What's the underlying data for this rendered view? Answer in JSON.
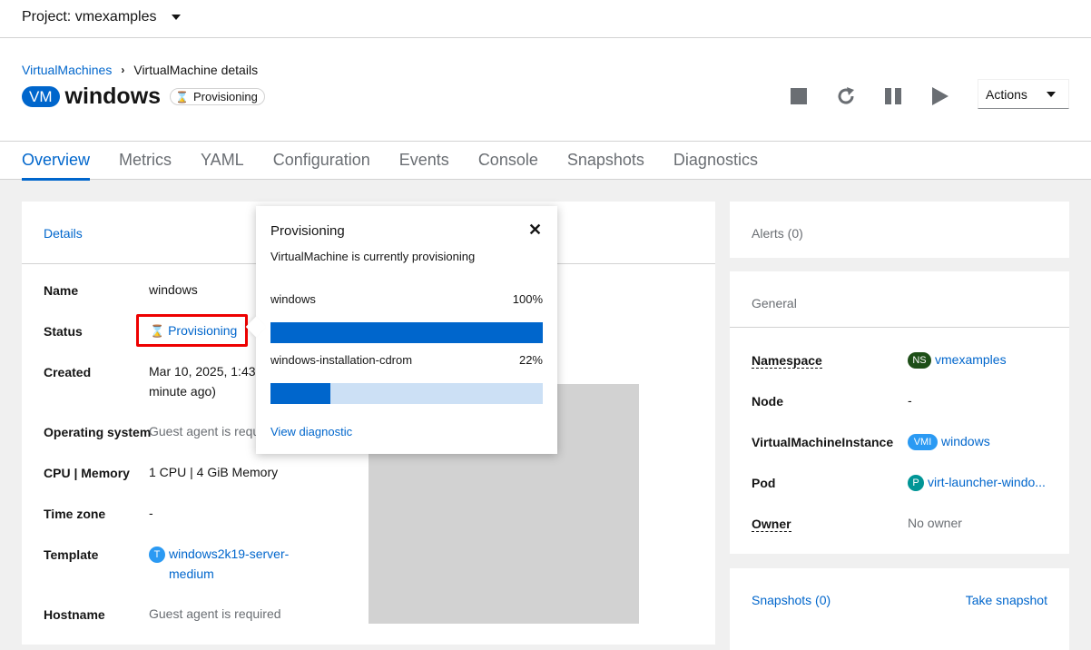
{
  "topbar": {
    "project_label": "Project: vmexamples"
  },
  "breadcrumb": {
    "parent": "VirtualMachines",
    "current": "VirtualMachine details"
  },
  "vm": {
    "badge": "VM",
    "name": "windows",
    "status": "Provisioning"
  },
  "actions": {
    "label": "Actions"
  },
  "tabs": [
    "Overview",
    "Metrics",
    "YAML",
    "Configuration",
    "Events",
    "Console",
    "Snapshots",
    "Diagnostics"
  ],
  "details": {
    "heading": "Details",
    "name_label": "Name",
    "name_value": "windows",
    "status_label": "Status",
    "status_value": "Provisioning",
    "created_label": "Created",
    "created_value_line1": "Mar 10, 2025, 1:43 P",
    "created_value_line2": "minute ago)",
    "os_label": "Operating system",
    "os_value": "Guest agent is requ",
    "cpu_label": "CPU | Memory",
    "cpu_value": "1 CPU | 4 GiB Memory",
    "tz_label": "Time zone",
    "tz_value": "-",
    "template_label": "Template",
    "template_badge": "T",
    "template_value_line1": "windows2k19-server-",
    "template_value_line2": "medium",
    "hostname_label": "Hostname",
    "hostname_value": "Guest agent is required"
  },
  "popover": {
    "title": "Provisioning",
    "description": "VirtualMachine is currently provisioning",
    "items": [
      {
        "name": "windows",
        "percent_label": "100%",
        "progress": 1.0
      },
      {
        "name": "windows-installation-cdrom",
        "percent_label": "22%",
        "progress": 0.22
      }
    ],
    "link": "View diagnostic"
  },
  "alerts": {
    "title": "Alerts (0)"
  },
  "general": {
    "title": "General",
    "namespace_label": "Namespace",
    "namespace_badge": "NS",
    "namespace_value": "vmexamples",
    "node_label": "Node",
    "node_value": "-",
    "vmi_label": "VirtualMachineInstance",
    "vmi_badge": "VMI",
    "vmi_value": "windows",
    "pod_label": "Pod",
    "pod_badge": "P",
    "pod_value": "virt-launcher-windo...",
    "owner_label": "Owner",
    "owner_value": "No owner"
  },
  "snapshots": {
    "title": "Snapshots (0)",
    "action": "Take snapshot"
  },
  "colors": {
    "accent": "#0066cc",
    "namespace_badge": "#1e4f18",
    "pod_badge": "#009596",
    "template_badge": "#2b9af3",
    "highlight": "#ee0000"
  }
}
